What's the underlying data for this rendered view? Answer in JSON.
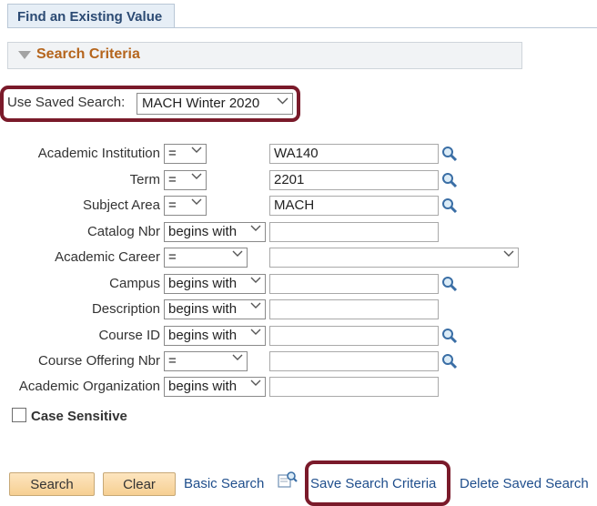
{
  "tab": {
    "label": "Find an Existing Value"
  },
  "criteria": {
    "title": "Search Criteria"
  },
  "saved_search": {
    "label": "Use Saved Search:",
    "value": "MACH Winter 2020"
  },
  "fields": [
    {
      "label": "Academic Institution",
      "operator": "=",
      "value": "WA140"
    },
    {
      "label": "Term",
      "operator": "=",
      "value": "2201"
    },
    {
      "label": "Subject Area",
      "operator": "=",
      "value": "MACH"
    },
    {
      "label": "Catalog Nbr",
      "operator": "begins with",
      "value": ""
    },
    {
      "label": "Academic Career",
      "operator": "=",
      "value": ""
    },
    {
      "label": "Campus",
      "operator": "begins with",
      "value": ""
    },
    {
      "label": "Description",
      "operator": "begins with",
      "value": ""
    },
    {
      "label": "Course ID",
      "operator": "begins with",
      "value": ""
    },
    {
      "label": "Course Offering Nbr",
      "operator": "=",
      "value": ""
    },
    {
      "label": "Academic Organization",
      "operator": "begins with",
      "value": ""
    }
  ],
  "case_sensitive": {
    "label": "Case Sensitive",
    "checked": false
  },
  "actions": {
    "search": "Search",
    "clear": "Clear",
    "basic_search": "Basic Search",
    "save_criteria": "Save Search Criteria",
    "delete_saved": "Delete Saved Search"
  },
  "colors": {
    "highlight_border": "#7a1a2a",
    "criteria_title": "#b5651d",
    "link": "#1f4e8c",
    "button": "#f6cf92"
  }
}
